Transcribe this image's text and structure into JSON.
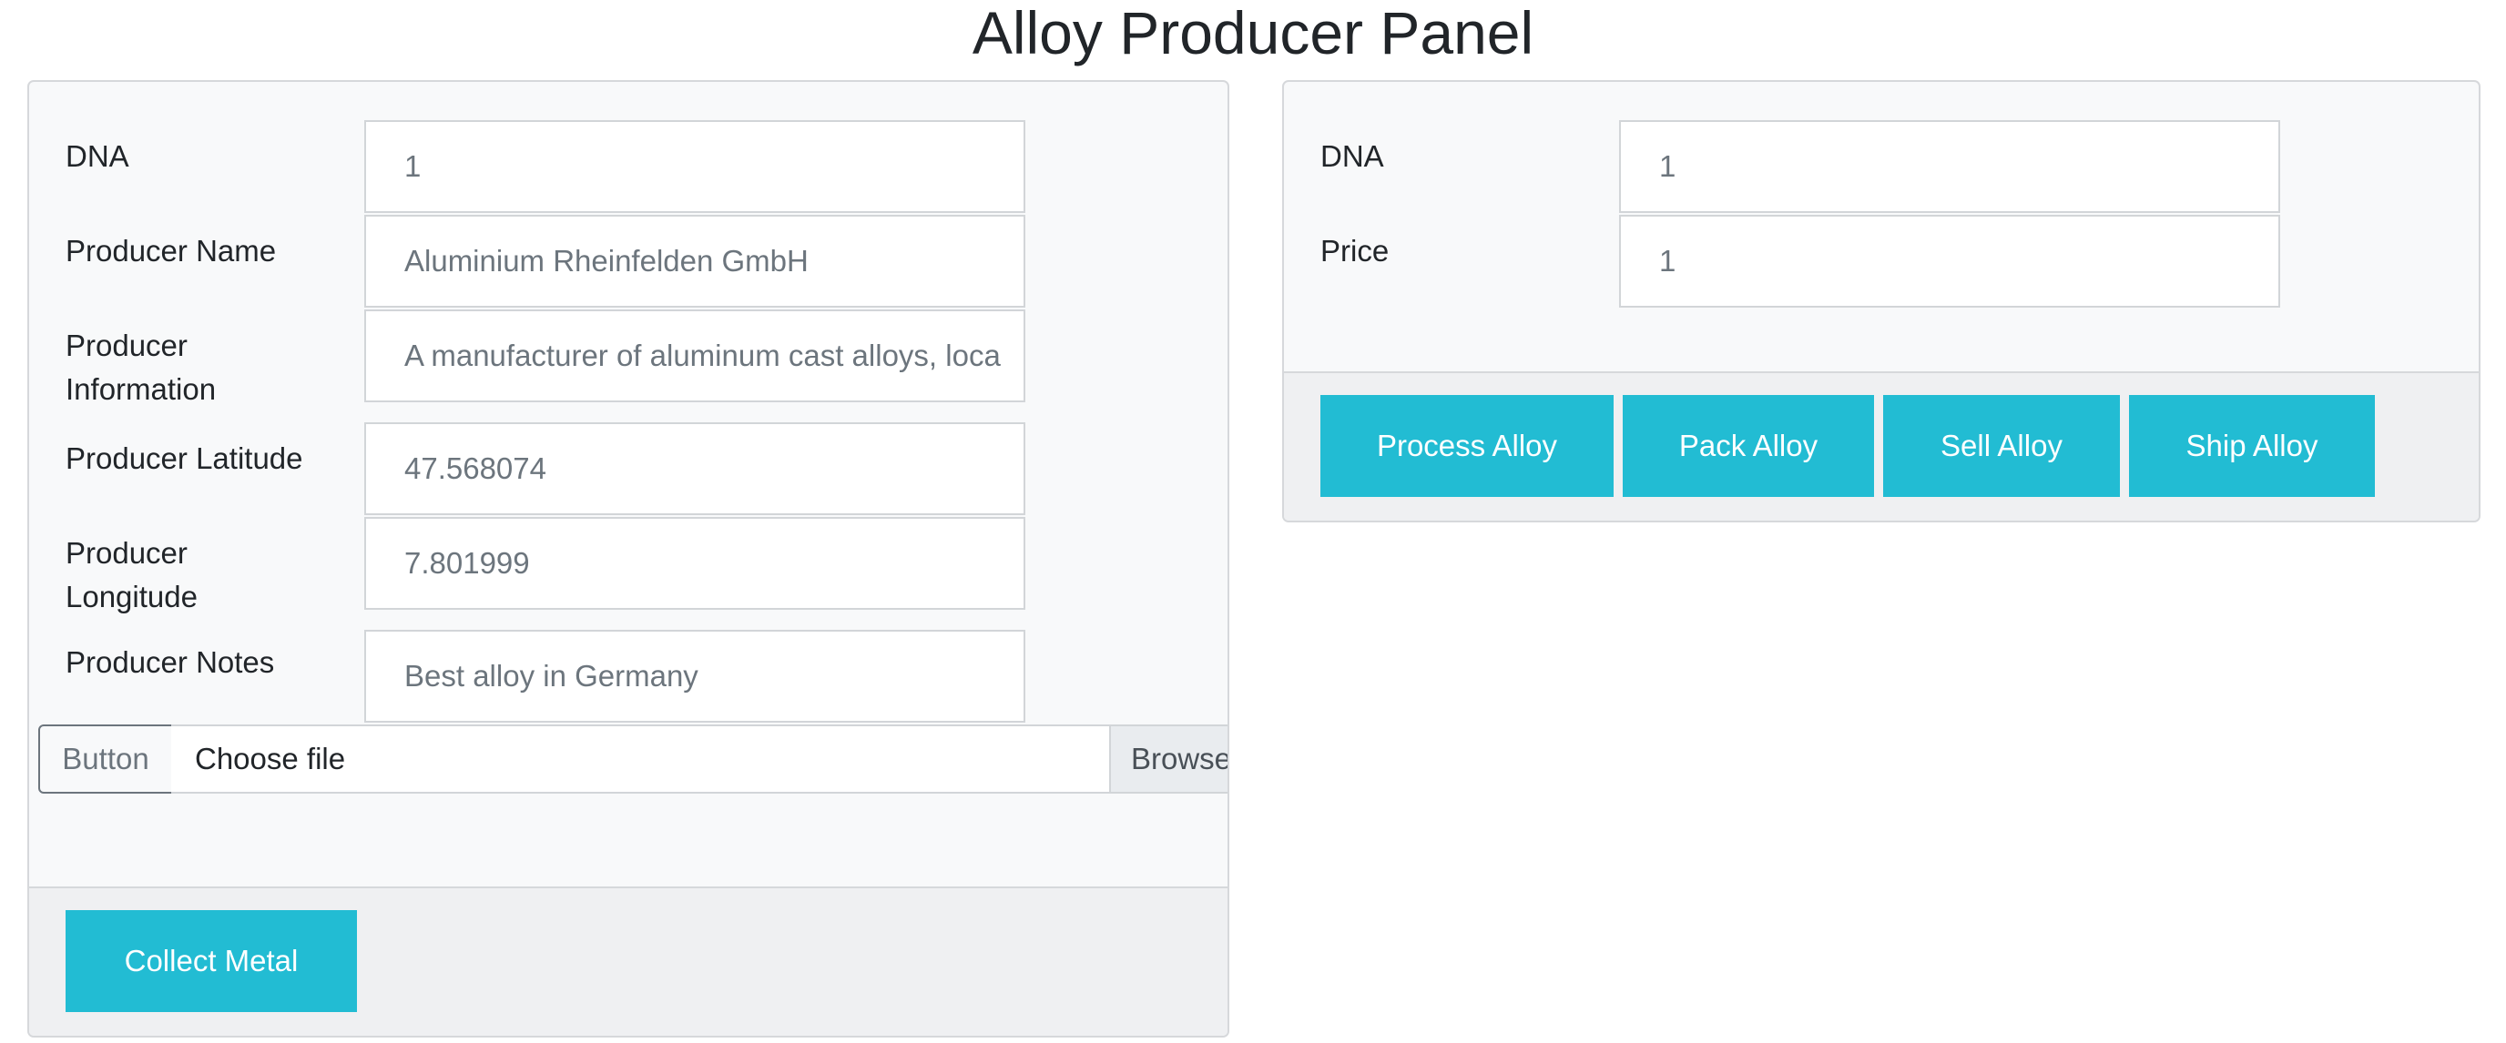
{
  "page": {
    "title": "Alloy Producer Panel"
  },
  "producer_form": {
    "dna": {
      "label": "DNA",
      "value": "1"
    },
    "producer_name": {
      "label": "Producer Name",
      "value": "Aluminium Rheinfelden GmbH"
    },
    "producer_information": {
      "label_line1": "Producer",
      "label_line2": "Information",
      "value": "A manufacturer of aluminum cast alloys, loca"
    },
    "producer_latitude": {
      "label": "Producer Latitude",
      "value": "47.568074"
    },
    "producer_longitude": {
      "label_line1": "Producer",
      "label_line2": "Longitude",
      "value": "7.801999"
    },
    "producer_notes": {
      "label": "Producer Notes",
      "value": "Best alloy in Germany"
    },
    "file_upload": {
      "button_label": "Button",
      "placeholder": "Choose file",
      "browse_label": "Browse"
    },
    "collect_button": "Collect Metal"
  },
  "alloy_form": {
    "dna": {
      "label": "DNA",
      "value": "1"
    },
    "price": {
      "label": "Price",
      "value": "1"
    },
    "actions": {
      "process": "Process Alloy",
      "pack": "Pack Alloy",
      "sell": "Sell Alloy",
      "ship": "Ship Alloy"
    }
  },
  "colors": {
    "accent": "#22bcd3",
    "card_bg": "#f8f9fa",
    "footer_bg": "#eff0f2"
  }
}
